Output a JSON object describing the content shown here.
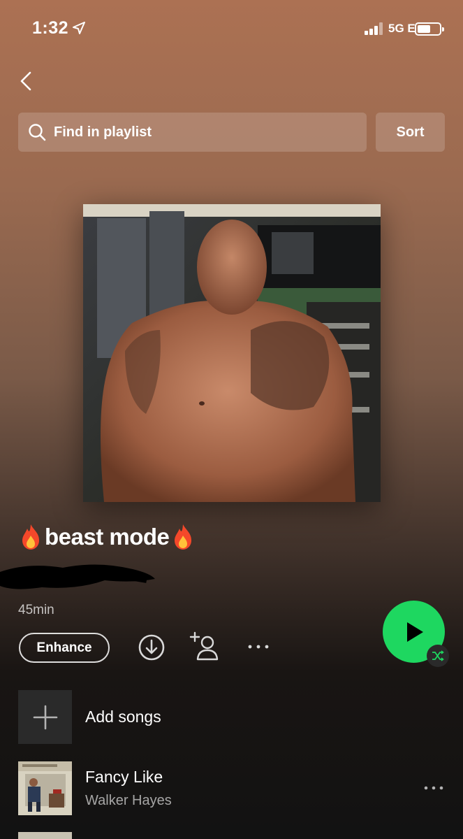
{
  "status_bar": {
    "time": "1:32",
    "network": "5G E",
    "icons": [
      "location-arrow-icon",
      "signal-icon",
      "battery-icon"
    ]
  },
  "header": {
    "search_placeholder": "Find in playlist",
    "sort_label": "Sort",
    "icons": [
      "back-chevron-icon",
      "search-icon"
    ]
  },
  "playlist": {
    "title": "beast mode",
    "title_emoji": "fire",
    "duration": "45min",
    "enhance_label": "Enhance",
    "icons": [
      "download-icon",
      "add-user-icon",
      "more-icon",
      "play-icon",
      "shuffle-icon"
    ]
  },
  "add_songs": {
    "label": "Add songs",
    "icon": "plus-icon"
  },
  "tracks": [
    {
      "title": "Fancy Like",
      "artist": "Walker Hayes"
    }
  ],
  "colors": {
    "accent_green": "#1ed760",
    "background_top": "#ac7153",
    "background_bottom": "#121212"
  }
}
